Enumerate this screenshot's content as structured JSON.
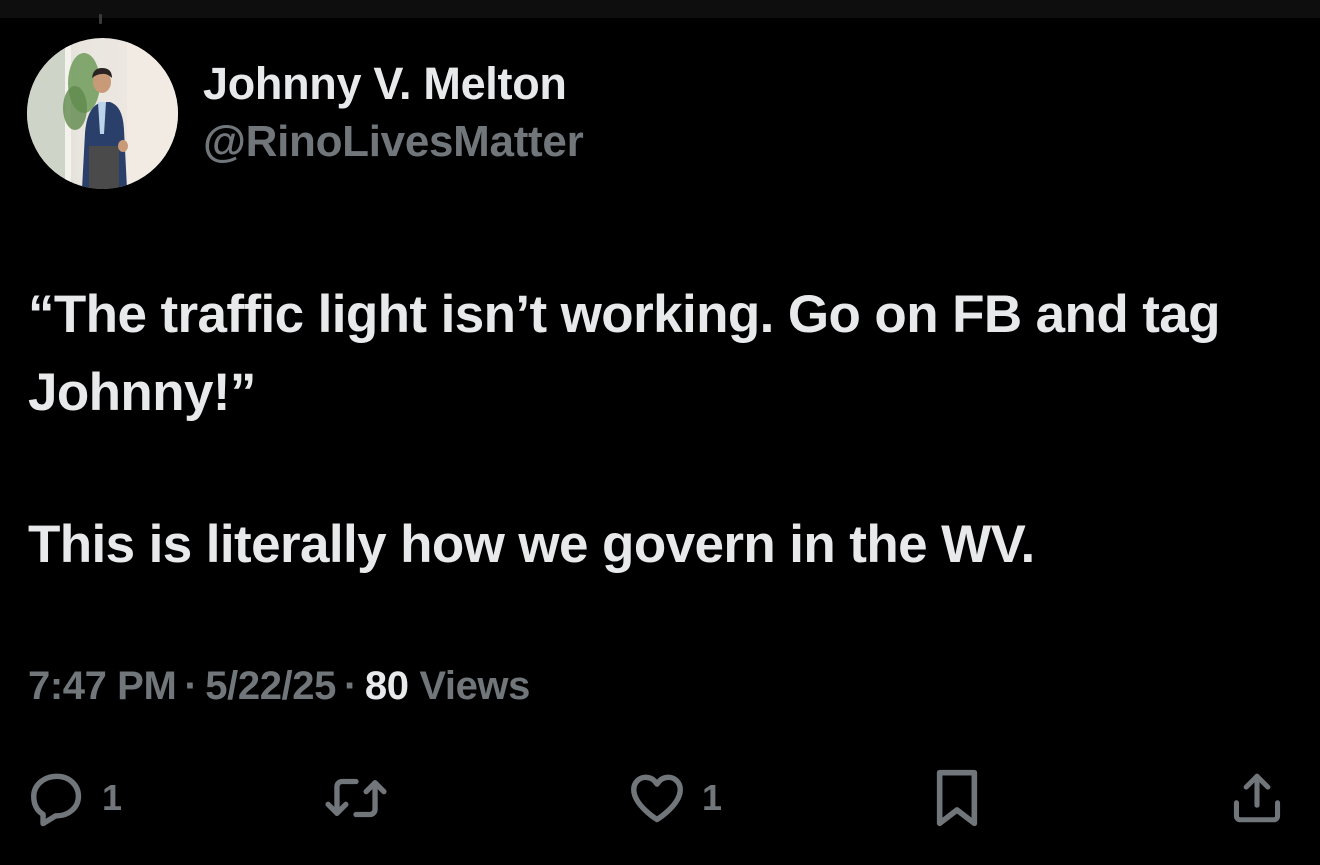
{
  "author": {
    "display_name": "Johnny V. Melton",
    "handle": "@RinoLivesMatter"
  },
  "tweet": {
    "paragraphs": [
      "“The traffic light isn’t working. Go on FB and tag Johnny!”",
      "This is literally how we govern in the WV."
    ]
  },
  "meta": {
    "time": "7:47 PM",
    "separator": "·",
    "date": "5/22/25",
    "views_count": "80",
    "views_label": "Views"
  },
  "actions": {
    "reply_count": "1",
    "retweet_count": "",
    "like_count": "1"
  },
  "icons": {
    "reply": "reply-icon",
    "retweet": "retweet-icon",
    "like": "heart-icon",
    "bookmark": "bookmark-icon",
    "share": "share-icon"
  },
  "colors": {
    "background": "#000000",
    "primary_text": "#e7e9ea",
    "secondary_text": "#71767b"
  }
}
